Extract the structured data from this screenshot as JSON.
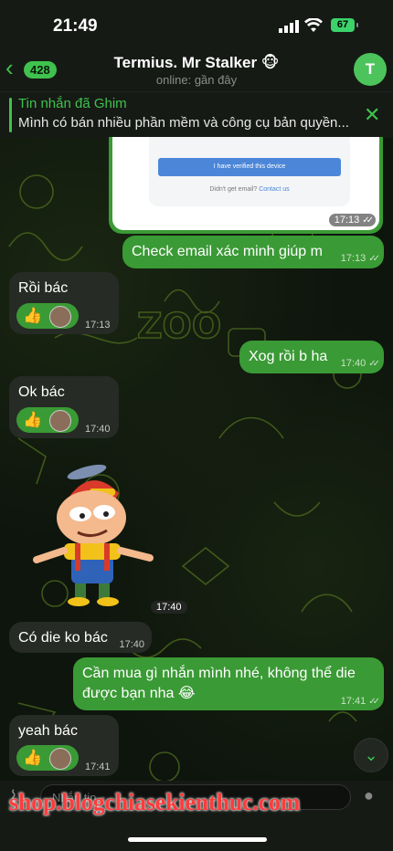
{
  "status_bar": {
    "time": "21:49",
    "battery": "67"
  },
  "header": {
    "back_count": "428",
    "title": "Termius. Mr Stalker 🐵",
    "subtitle": "online: gần đây",
    "avatar_initial": "T"
  },
  "pinned": {
    "title": "Tin nhắn đã Ghim",
    "text": "Mình có bán nhiều phần mềm và công cụ bản quyền..."
  },
  "image_message": {
    "button_text": "I have verified this device",
    "hint_text": "Didn't get email?",
    "hint_link": "Contact us",
    "time": "17:13"
  },
  "messages": [
    {
      "dir": "out",
      "text": "Check email xác minh giúp m",
      "time": "17:13"
    },
    {
      "dir": "in",
      "text": "Rồi bác",
      "time": "17:13",
      "reaction": "👍"
    },
    {
      "dir": "out",
      "text": "Xog rồi b ha",
      "time": "17:40"
    },
    {
      "dir": "in",
      "text": "Ok bác",
      "time": "17:40",
      "reaction": "👍"
    },
    {
      "dir": "in",
      "type": "sticker",
      "time": "17:40"
    },
    {
      "dir": "in",
      "text": "Có die ko bác",
      "time": "17:40"
    },
    {
      "dir": "out",
      "text_line1": "Cần mua gì nhắn mình nhé, không thể die",
      "text_line2": "được bạn nha 😂",
      "time": "17:41"
    },
    {
      "dir": "in",
      "text": "yeah bác",
      "time": "17:41",
      "reaction": "👍"
    }
  ],
  "composer": {
    "placeholder": "Nhắn tin"
  },
  "watermark": "shop.blogchiasekienthuc.com",
  "colors": {
    "accent": "#3fc24e",
    "outgoing_bubble": "#3a9a35",
    "incoming_bubble": "#262b25"
  }
}
